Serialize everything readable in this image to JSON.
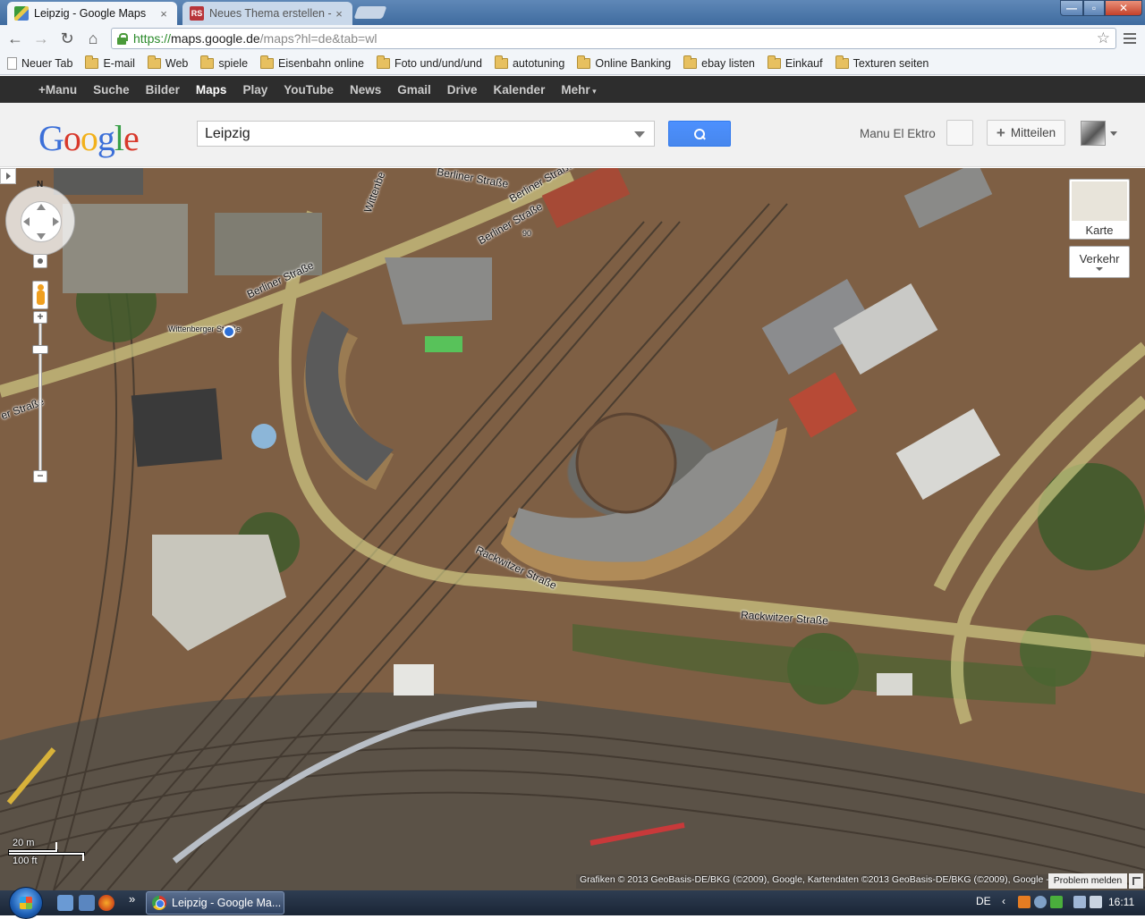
{
  "browser": {
    "tabs": [
      {
        "title": "Leipzig - Google Maps",
        "active": true
      },
      {
        "title": "Neues Thema erstellen - P",
        "active": false
      }
    ],
    "tab2_favicon_text": "RS",
    "close_glyph": "×",
    "url_scheme": "https://",
    "url_host": "maps.google.de",
    "url_path": "/maps?hl=de&tab=wl",
    "star_glyph": "☆",
    "nav_glyphs": {
      "back": "←",
      "forward": "→",
      "reload": "↻",
      "home": "⌂"
    },
    "window_glyphs": {
      "minimize": "—",
      "maximize": "▫",
      "close": "✕"
    }
  },
  "bookmarks": [
    {
      "label": "Neuer Tab",
      "type": "page"
    },
    {
      "label": "E-mail",
      "type": "folder"
    },
    {
      "label": "Web",
      "type": "folder"
    },
    {
      "label": "spiele",
      "type": "folder"
    },
    {
      "label": "Eisenbahn online",
      "type": "folder"
    },
    {
      "label": "Foto und/und/und",
      "type": "folder"
    },
    {
      "label": "autotuning",
      "type": "folder"
    },
    {
      "label": "Online Banking",
      "type": "folder"
    },
    {
      "label": "ebay listen",
      "type": "folder"
    },
    {
      "label": "Einkauf",
      "type": "folder"
    },
    {
      "label": "Texturen seiten",
      "type": "folder"
    }
  ],
  "gbar": {
    "items": [
      "+Manu",
      "Suche",
      "Bilder",
      "Maps",
      "Play",
      "YouTube",
      "News",
      "Gmail",
      "Drive",
      "Kalender"
    ],
    "active": "Maps",
    "more": "Mehr"
  },
  "header": {
    "logo_letters": [
      "G",
      "o",
      "o",
      "g",
      "l",
      "e"
    ],
    "search_value": "Leipzig",
    "username": "Manu El Ektro",
    "share_plus": "+",
    "share_label": "Mitteilen"
  },
  "map": {
    "street_labels": [
      "Berliner Straße",
      "Berliner Straße",
      "Berliner Straße",
      "Berliner Straße",
      "Rackwitzer Straße",
      "Rackwitzer Straße",
      "er Straße",
      "Wittenbe",
      "Wittenberger Straße",
      "90"
    ],
    "compass": "N",
    "zoom_in": "+",
    "zoom_out": "−",
    "map_type_button": "Karte",
    "traffic_button": "Verkehr",
    "scale_metric": "20 m",
    "scale_imperial": "100 ft",
    "copyright": "Grafiken © 2013 GeoBasis-DE/BKG (©2009), Google, Kartendaten ©2013 GeoBasis-DE/BKG (©2009), Google -",
    "report_problem": "Problem melden",
    "colors": {
      "road_overlay": "#d7d38a",
      "terrain": "#6b6a58",
      "rail": "#5a4d40",
      "roof": "#8a8a88"
    }
  },
  "taskbar": {
    "quicklaunch_more": "»",
    "task_item": "Leipzig - Google Ma...",
    "language": "DE",
    "tray_arrow": "‹",
    "clock": "16:11"
  }
}
